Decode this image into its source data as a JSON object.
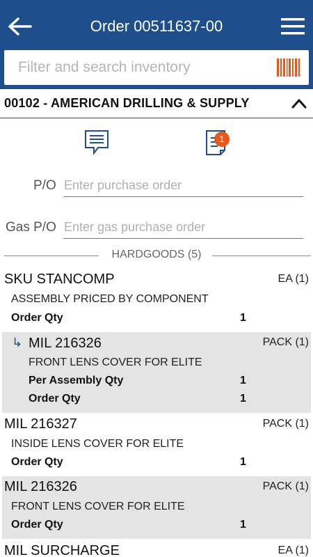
{
  "header": {
    "title": "Order 00511637-00",
    "back_icon": "arrow-left-icon",
    "menu_icon": "hamburger-menu-icon",
    "color": "#1f4e8c"
  },
  "search": {
    "placeholder": "Filter and search inventory",
    "scan_icon": "barcode-icon",
    "scan_color": "#e8581c"
  },
  "customer": {
    "name": "00102 -  AMERICAN DRILLING & SUPPLY",
    "toggle_icon": "chevron-up-icon"
  },
  "actions": {
    "messages_icon": "message-icon",
    "notes_icon": "notes-icon",
    "notes_badge": "1",
    "badge_color": "#e8581c"
  },
  "form": {
    "po_label": "P/O",
    "po_placeholder": "Enter purchase order",
    "gas_po_label": "Gas P/O",
    "gas_po_placeholder": "Enter gas purchase order"
  },
  "section": {
    "label": "HARDGOODS (5)"
  },
  "items": [
    {
      "sku": "SKU STANCOMP",
      "unit": "EA (1)",
      "description": "ASSEMBLY PRICED BY COMPONENT",
      "order_qty_label": "Order Qty",
      "order_qty": "1"
    },
    {
      "sku": "MIL 216326",
      "unit": "PACK (1)",
      "description": "FRONT LENS COVER FOR ELITE",
      "per_assembly_label": "Per Assembly Qty",
      "per_assembly_qty": "1",
      "order_qty_label": "Order Qty",
      "order_qty": "1",
      "child_icon": "subdirectory-arrow-icon"
    },
    {
      "sku": "MIL 216327",
      "unit": "PACK (1)",
      "description": "INSIDE LENS COVER FOR ELITE",
      "order_qty_label": "Order Qty",
      "order_qty": "1"
    },
    {
      "sku": "MIL 216326",
      "unit": "PACK (1)",
      "description": "FRONT LENS COVER FOR ELITE",
      "order_qty_label": "Order Qty",
      "order_qty": "1"
    },
    {
      "sku": "MIL SURCHARGE",
      "unit": "EA (1)"
    }
  ]
}
